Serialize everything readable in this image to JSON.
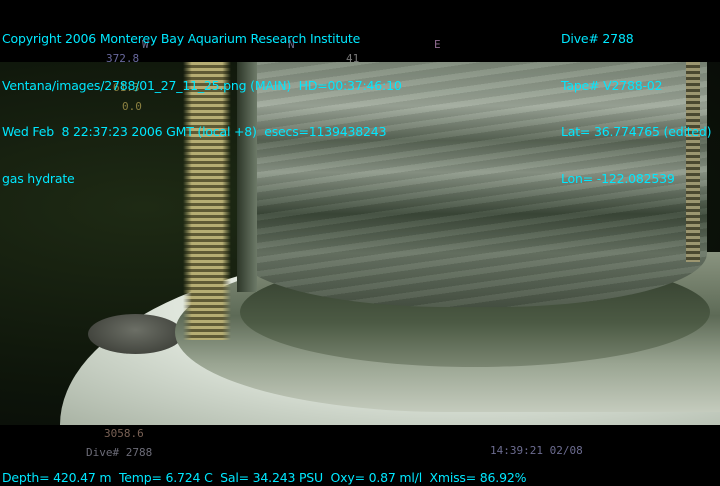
{
  "overlay_top_left": [
    "Copyright 2006 Monterey Bay Aquarium Research Institute",
    "Ventana/images/2788/01_27_11_25.png (MAIN)  HD=00:37:46:10",
    "Wed Feb  8 22:37:23 2006 GMT (local +8)  esecs=1139438243",
    "gas hydrate"
  ],
  "overlay_top_right": [
    "Dive# 2788",
    "Tape# V2788-02",
    "Lat= 36.774765 (edited)",
    "Lon= -122.082539"
  ],
  "overlay_bottom": "Depth= 420.47 m  Temp= 6.724 C  Sal= 34.243 PSU  Oxy= 0.87 ml/l  Xmiss= 86.92%",
  "camera_overlay": {
    "heading": "372.8",
    "heading_right": "41",
    "val1": "61.3",
    "val2": "0.0",
    "compass_w": "W",
    "compass_n": "N",
    "compass_e": "E",
    "bottom_value": "3058.6",
    "dive": "Dive# 2788",
    "time": "14:39:21 02/08"
  }
}
